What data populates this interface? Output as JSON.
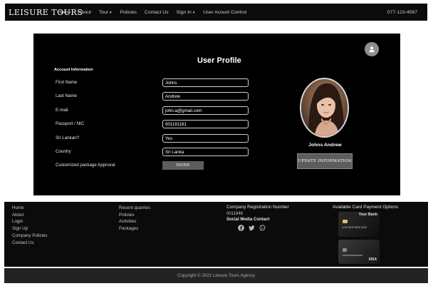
{
  "navbar": {
    "brand": "LEISURE TOURS",
    "items": [
      {
        "label": "Home",
        "dropdown": false
      },
      {
        "label": "About",
        "dropdown": false
      },
      {
        "label": "Tour",
        "dropdown": true
      },
      {
        "label": "Policies",
        "dropdown": false
      },
      {
        "label": "Contact Us",
        "dropdown": false
      },
      {
        "label": "Sign In",
        "dropdown": true
      },
      {
        "label": "User Acount Control",
        "dropdown": false
      }
    ],
    "phone": "077-123-4567"
  },
  "profile": {
    "title": "User Profile",
    "section": "Account Information",
    "fields": [
      {
        "label": "First Name",
        "value": "Johns"
      },
      {
        "label": "Last Name",
        "value": "Andrew"
      },
      {
        "label": "E-mail",
        "value": "john.a@gmail.com"
      },
      {
        "label": "Passport / NIC",
        "value": "901181181"
      },
      {
        "label": "Sri Lankan?",
        "value": "Yes"
      },
      {
        "label": "Country",
        "value": "Sri Lanka"
      }
    ],
    "approval_label": "Customized package Approval",
    "approval_value": "NONE",
    "user_name": "Johns Andrew",
    "update_button": "UPDATE INFORMATION",
    "user_icon": "user-circle-icon"
  },
  "footer": {
    "col1": [
      "Home",
      "About",
      "Login",
      "Sign Up",
      "Company Policies",
      "Contact Us"
    ],
    "col2": [
      "Recent quarries",
      "Policies",
      "Activities",
      "Packages"
    ],
    "registration_heading": "Company Registration Number",
    "registration_number": "0011946",
    "social_heading": "Social Media Contact",
    "social_icons": [
      "facebook-icon",
      "twitter-icon",
      "whatsapp-icon"
    ],
    "payment_heading": "Available Card Payment Options",
    "card1": {
      "bank": "Your Bank",
      "number": "1234 5678 9876 5432",
      "brand": ""
    },
    "card2": {
      "brand": "VISA"
    },
    "copyright": "Copyright © 2021 Leisure Tours Agency"
  },
  "colors": {
    "nav_bg": "#0b0b0b",
    "card_bg": "#000000",
    "button_gray": "#5d5d5d",
    "footer_bg": "#0b0b0b",
    "copyright_bg": "#232323"
  }
}
